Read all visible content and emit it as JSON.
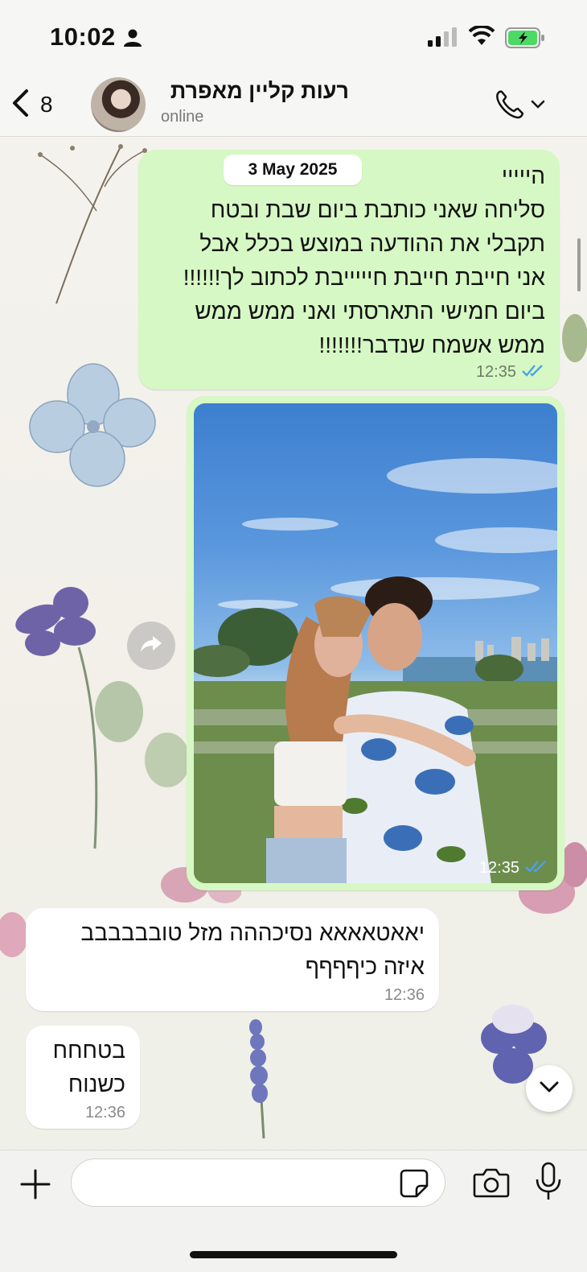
{
  "status_bar": {
    "time": "10:02"
  },
  "header": {
    "back_count": "8",
    "contact_name": "רעות קליין מאפרת",
    "contact_status": "online"
  },
  "chat": {
    "date_label": "3 May 2025",
    "messages": [
      {
        "direction": "out",
        "type": "text",
        "text": "הייייי\nסליחה שאני כותבת ביום שבת ובטח\nתקבלי את ההודעה במוצש בכלל אבל\nאני חייבת חייבת חיייייבת לכתוב לך!!!!!!\nביום חמישי התארסתי ואני ממש ממש\nממש אשמח שנדבר!!!!!!!",
        "time": "12:35",
        "status": "read"
      },
      {
        "direction": "out",
        "type": "photo",
        "time": "12:35",
        "status": "read"
      },
      {
        "direction": "in",
        "type": "text",
        "text": "יאאטאאאא נסיכההה מזל טובבבבבב\nאיזה כיףףףף",
        "time": "12:36"
      },
      {
        "direction": "in",
        "type": "text",
        "text": "בטחחח\nכשנוח",
        "time": "12:36"
      }
    ]
  },
  "input": {
    "placeholder": ""
  },
  "icons": {
    "back": "chevron-left-icon",
    "status_person": "person-icon",
    "signal": "signal-icon",
    "wifi": "wifi-icon",
    "battery": "battery-charging-icon",
    "call": "phone-icon",
    "read_receipt": "double-check-icon",
    "forward": "forward-icon",
    "scroll_down": "chevron-down-icon",
    "plus": "plus-icon",
    "sticker": "sticker-icon",
    "camera": "camera-icon",
    "mic": "microphone-icon"
  },
  "colors": {
    "outgoing_bubble": "#d6f8c4",
    "incoming_bubble": "#ffffff",
    "read_tick": "#4aa3e8",
    "battery_fill": "#4cd964"
  }
}
